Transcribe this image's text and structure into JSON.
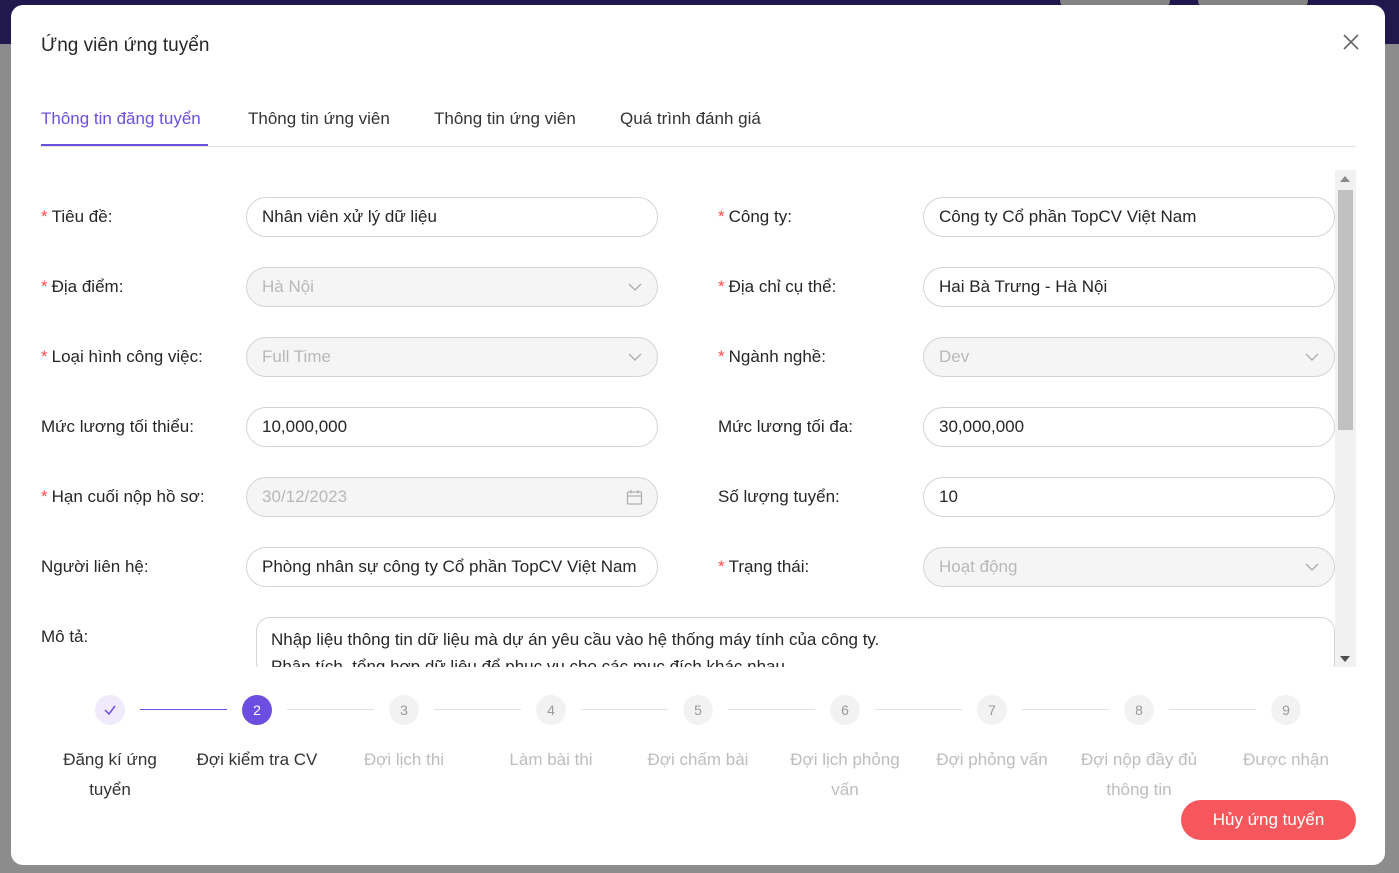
{
  "modal": {
    "title": "Ứng viên ứng tuyển",
    "tabs": [
      {
        "label": "Thông tin đăng tuyển",
        "active": true
      },
      {
        "label": "Thông tin ứng viên",
        "active": false
      },
      {
        "label": "Thông tin ứng viên",
        "active": false
      },
      {
        "label": "Quá trình đánh giá",
        "active": false
      }
    ]
  },
  "form": {
    "title": {
      "label": "Tiêu đề",
      "required": true,
      "value": "Nhân viên xử lý dữ liệu"
    },
    "company": {
      "label": "Công ty",
      "required": true,
      "value": "Công ty Cổ phần TopCV Việt Nam"
    },
    "location": {
      "label": "Địa điểm",
      "required": true,
      "value": "Hà Nội"
    },
    "address": {
      "label": "Địa chỉ cụ thể",
      "required": true,
      "value": "Hai Bà Trưng - Hà Nội"
    },
    "job_type": {
      "label": "Loại hình công việc",
      "required": true,
      "value": "Full Time"
    },
    "industry": {
      "label": "Ngành nghề",
      "required": true,
      "value": "Dev"
    },
    "min_salary": {
      "label": "Mức lương tối thiểu",
      "required": false,
      "value": "10,000,000"
    },
    "max_salary": {
      "label": "Mức lương tối đa",
      "required": false,
      "value": "30,000,000"
    },
    "deadline": {
      "label": "Hạn cuối nộp hồ sơ",
      "required": true,
      "value": "30/12/2023"
    },
    "quantity": {
      "label": "Số lượng tuyển",
      "required": false,
      "value": "10"
    },
    "contact": {
      "label": "Người liên hệ",
      "required": false,
      "value": "Phòng nhân sự công ty Cổ phần TopCV Việt Nam"
    },
    "status": {
      "label": "Trạng thái",
      "required": true,
      "value": "Hoạt động"
    },
    "description": {
      "label": "Mô tả",
      "line1": "Nhập liệu thông tin dữ liệu mà dự án yêu cầu vào hệ thống máy tính của công ty.",
      "line2": "Phân tích, tổng hợp dữ liệu để phục vụ cho các mục đích khác nhau."
    }
  },
  "steps": [
    {
      "number": "1",
      "label": "Đăng kí ứng tuyển",
      "state": "done"
    },
    {
      "number": "2",
      "label": "Đợi kiểm tra CV",
      "state": "current"
    },
    {
      "number": "3",
      "label": "Đợi lịch thi",
      "state": "todo"
    },
    {
      "number": "4",
      "label": "Làm bài thi",
      "state": "todo"
    },
    {
      "number": "5",
      "label": "Đợi chấm bài",
      "state": "todo"
    },
    {
      "number": "6",
      "label": "Đợi lịch phỏng vấn",
      "state": "todo"
    },
    {
      "number": "7",
      "label": "Đợi phỏng vấn",
      "state": "todo"
    },
    {
      "number": "8",
      "label": "Đợi nộp đầy đủ thông tin",
      "state": "todo"
    },
    {
      "number": "9",
      "label": "Được nhận",
      "state": "todo"
    }
  ],
  "actions": {
    "cancel_label": "Hủy ứng tuyển"
  },
  "colors": {
    "accent": "#6c4fe0",
    "danger": "#f5575c",
    "required": "#ff4d4f"
  }
}
